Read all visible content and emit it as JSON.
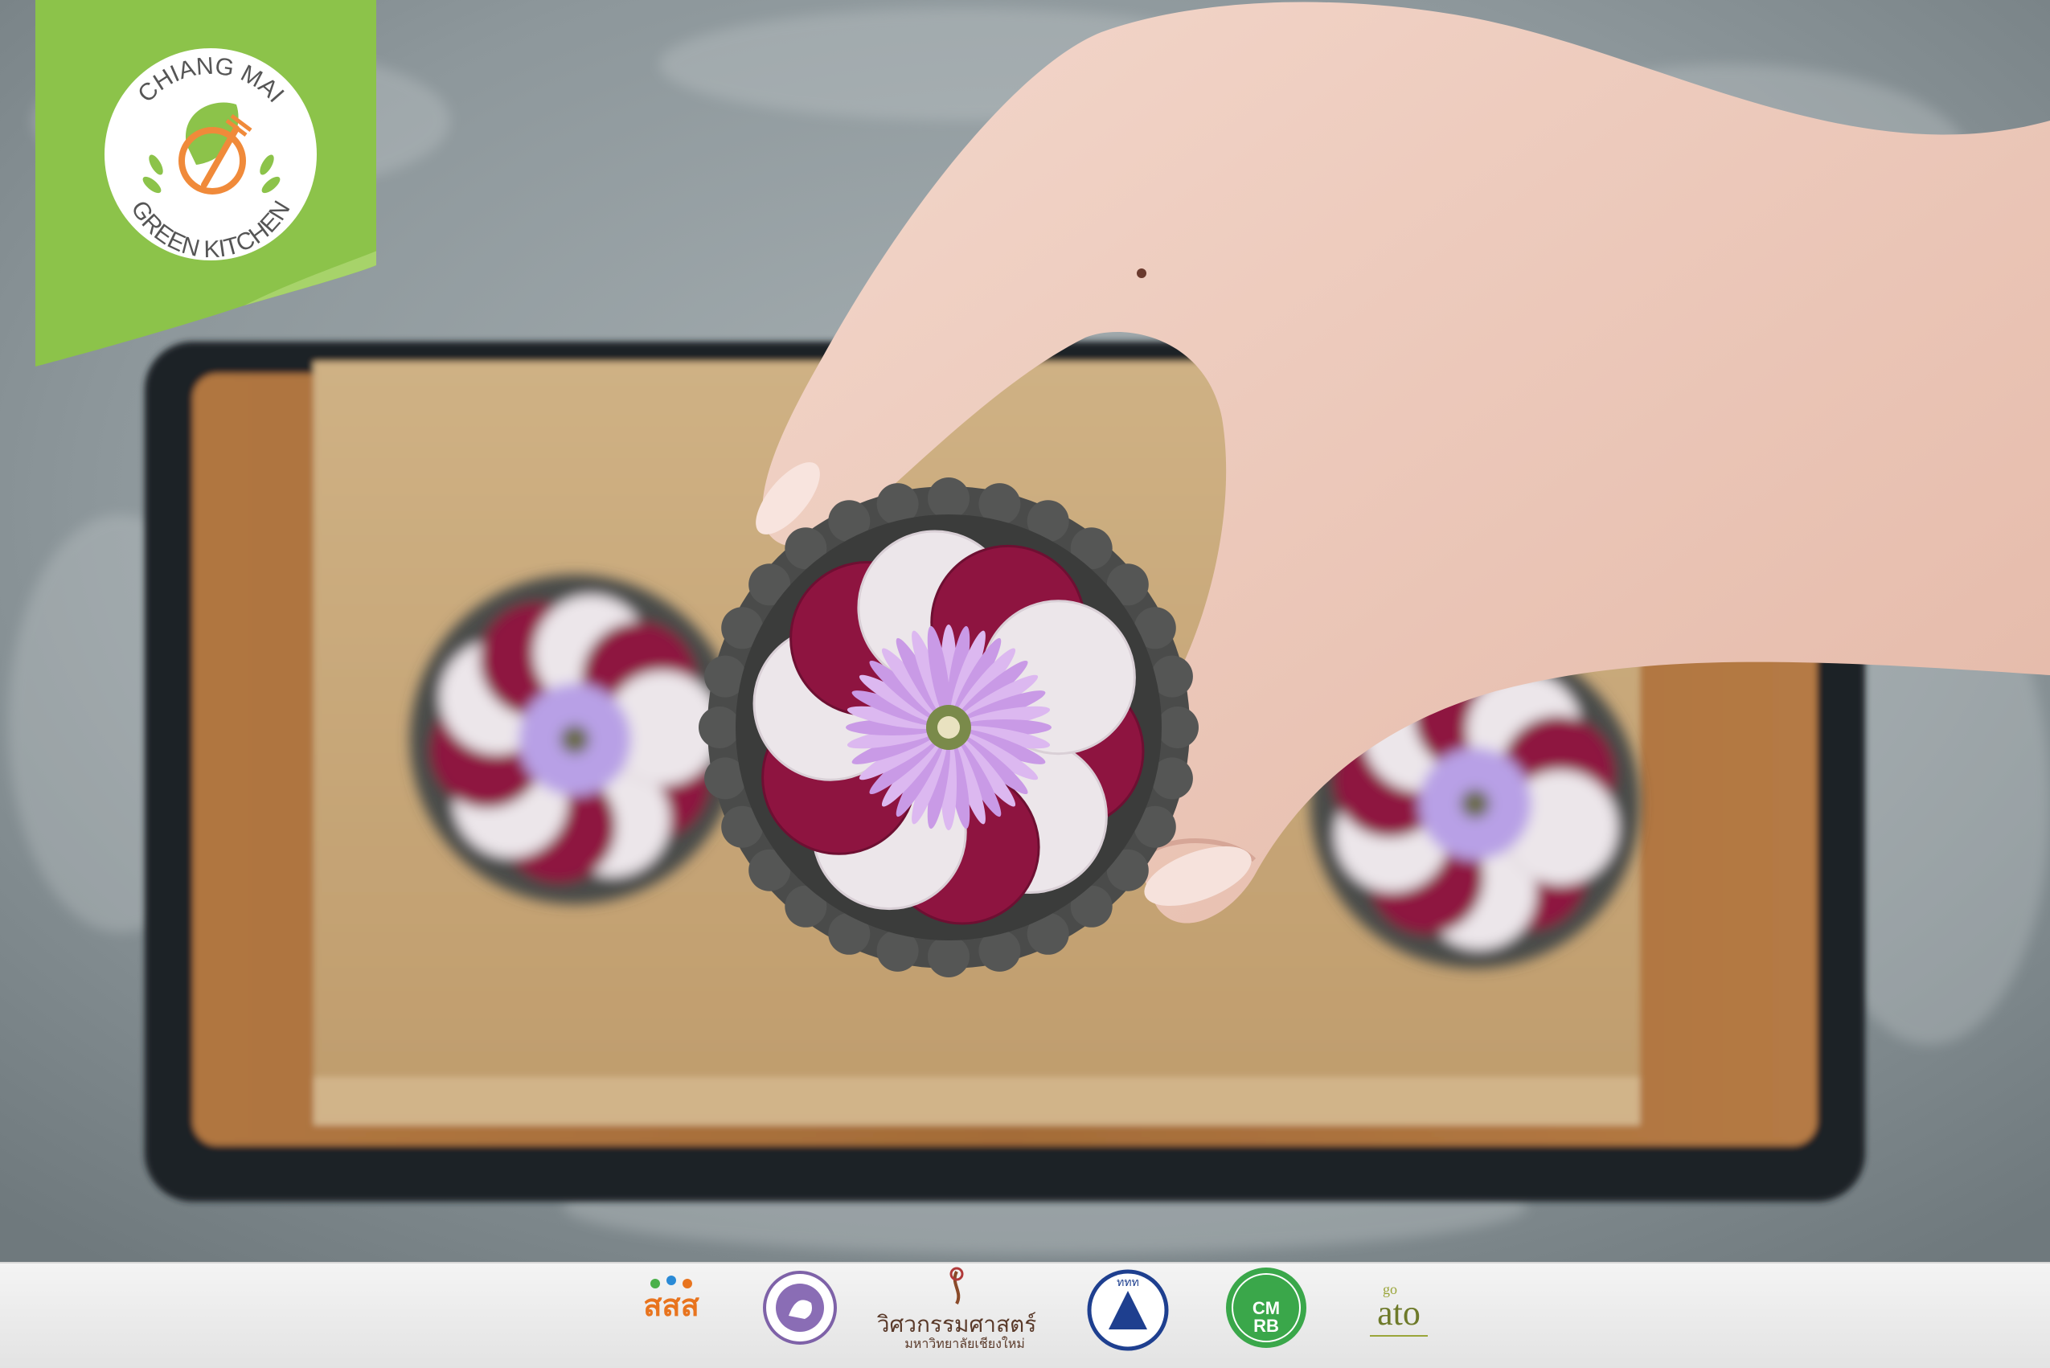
{
  "badge": {
    "line1": "CHIANG MAI",
    "line2": "GREEN KITCHEN",
    "color": "#8cc34a"
  },
  "footer": {
    "logos": [
      {
        "name": "sss-logo",
        "text": "สสส"
      },
      {
        "name": "elephant-seal-logo",
        "text": ""
      },
      {
        "name": "cmu-engineering-logo",
        "text": "วิศวกรรมศาสตร์",
        "subtext": "มหาวิทยาลัยเชียงใหม่"
      },
      {
        "name": "tat-logo",
        "text": "ททท"
      },
      {
        "name": "cmrb-logo",
        "text": "CMRB"
      },
      {
        "name": "goato-logo",
        "text": "ato"
      }
    ]
  },
  "colors": {
    "beet": "#8e1440",
    "radish": "#ece6ea",
    "flower": "#c99ae6",
    "crust": "#4a4b4a",
    "board": "#a06a3a",
    "burlap": "#c9a77a",
    "tray": "#1f2326"
  }
}
